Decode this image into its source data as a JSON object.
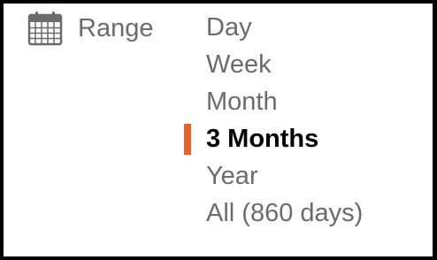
{
  "range": {
    "icon": "calendar-icon",
    "label": "Range",
    "options": [
      {
        "label": "Day",
        "selected": false
      },
      {
        "label": "Week",
        "selected": false
      },
      {
        "label": "Month",
        "selected": false
      },
      {
        "label": "3 Months",
        "selected": true
      },
      {
        "label": "Year",
        "selected": false
      },
      {
        "label": "All (860 days)",
        "selected": false
      }
    ]
  },
  "colors": {
    "accent": "#e8602c",
    "text_muted": "#6b6b6b",
    "text_selected": "#000000"
  }
}
